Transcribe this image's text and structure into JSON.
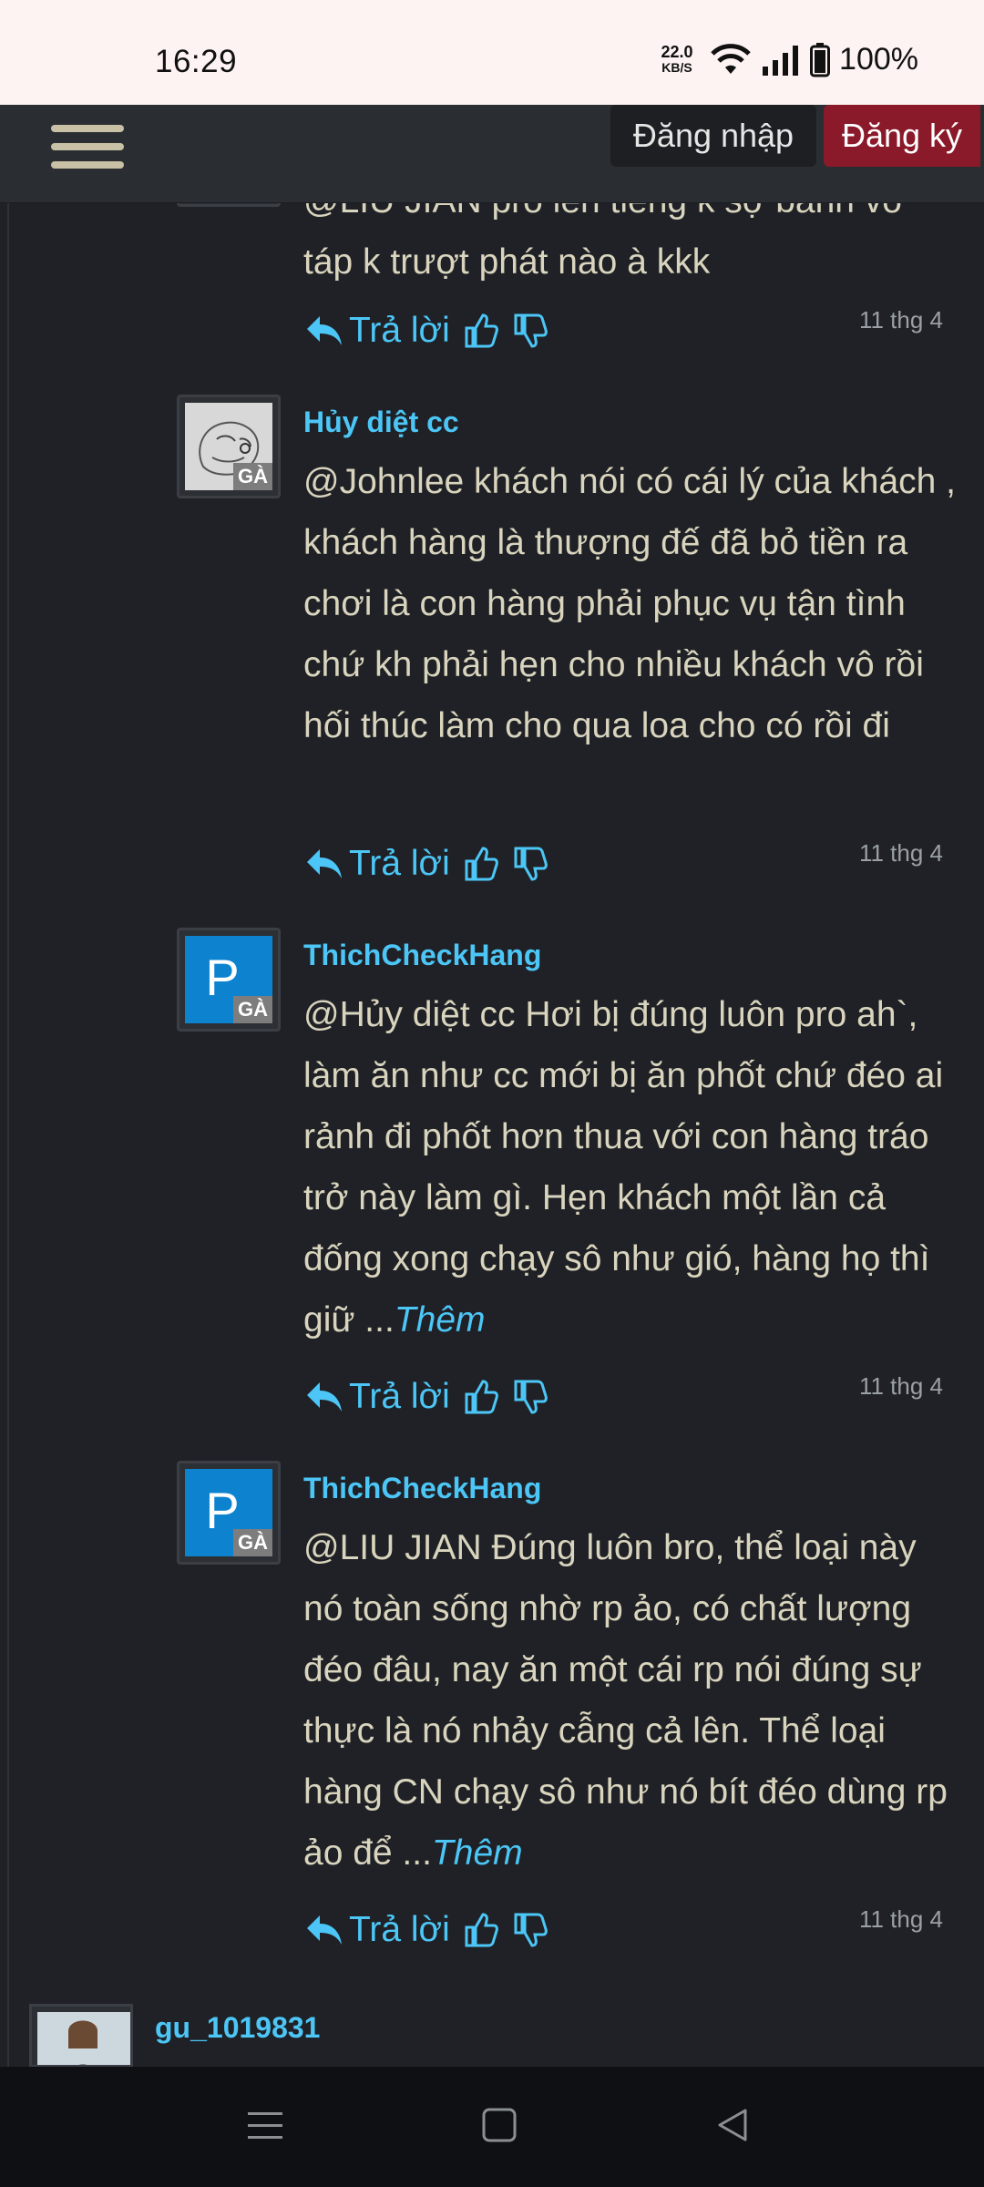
{
  "status_bar": {
    "time": "16:29",
    "net_speed_value": "22.0",
    "net_speed_unit": "KB/S",
    "battery": "100%"
  },
  "nav": {
    "login": "Đăng nhập",
    "register": "Đăng ký"
  },
  "comments": [
    {
      "author": "",
      "text": "@LIU JIAN pro lên tiếng k sợ banh vo táp k trượt phát nào à kkk",
      "reply": "Trả lời",
      "date": "11 thg 4"
    },
    {
      "author": "Hủy diệt cc",
      "badge": "GÀ",
      "text": "@Johnlee khách nói có cái lý của khách , khách hàng là thượng đế đã bỏ tiền ra chơi là con hàng phải phục vụ tận tình chứ kh phải hẹn cho nhiều khách vô rồi hối thúc làm cho qua loa cho có rồi đi",
      "reply": "Trả lời",
      "date": "11 thg 4"
    },
    {
      "author": "ThichCheckHang",
      "avatar_letter": "P",
      "badge": "GÀ",
      "text": "@Hủy diệt cc Hơi bị đúng luôn pro ah`, làm ăn như cc mới bị ăn phốt chứ đéo ai rảnh đi phốt hơn thua với con hàng tráo trở này làm gì. Hẹn khách một lần cả đống xong chạy sô như gió, hàng họ thì giữ ...",
      "more": "Thêm",
      "reply": "Trả lời",
      "date": "11 thg 4"
    },
    {
      "author": "ThichCheckHang",
      "avatar_letter": "P",
      "badge": "GÀ",
      "text": "@LIU JIAN Đúng luôn bro, thể loại này nó toàn sống nhờ rp ảo, có chất lượng đéo đâu, nay ăn một cái rp nói đúng sự thực là nó nhảy cẫng cả lên. Thể loại hàng CN chạy sô như nó bít đéo dùng rp ảo để ...",
      "more": "Thêm",
      "reply": "Trả lời",
      "date": "11 thg 4"
    },
    {
      "author": "gu_1019831"
    }
  ]
}
